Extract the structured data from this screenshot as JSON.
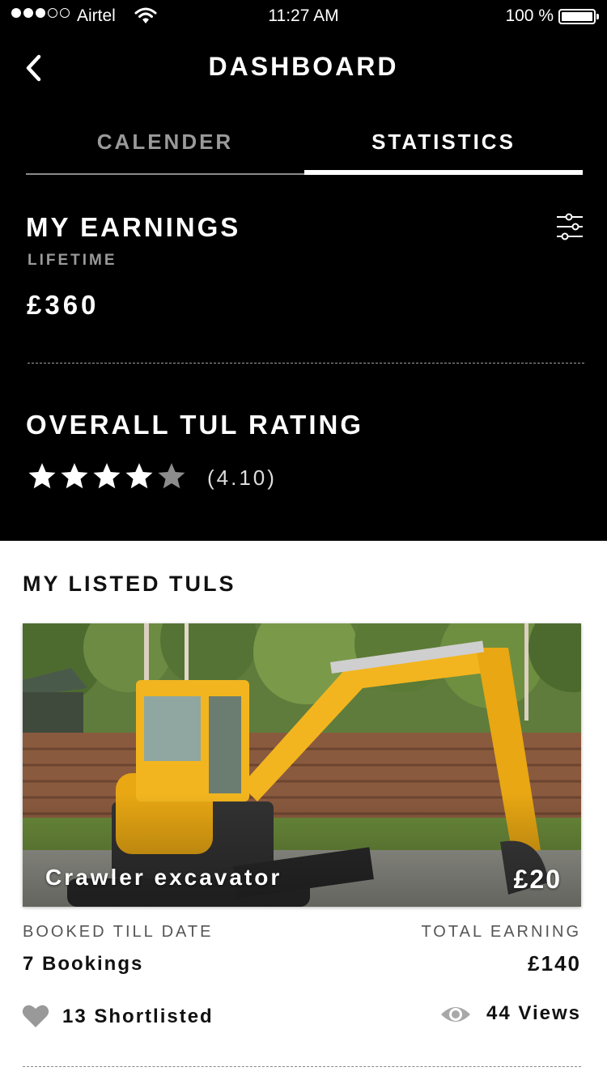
{
  "status_bar": {
    "carrier": "Airtel",
    "time": "11:27 AM",
    "battery": "100 %"
  },
  "header": {
    "title": "DASHBOARD"
  },
  "tabs": [
    {
      "label": "CALENDER",
      "active": false
    },
    {
      "label": "STATISTICS",
      "active": true
    }
  ],
  "earnings": {
    "title": "MY EARNINGS",
    "period": "LIFETIME",
    "value": "£360"
  },
  "rating": {
    "title": "OVERALL TUL RATING",
    "stars_filled": 4,
    "stars_total": 5,
    "value": "(4.10)"
  },
  "listed": {
    "title": "MY LISTED TULS",
    "items": [
      {
        "name": "Crawler excavator",
        "price": "£20",
        "booked_label": "BOOKED TILL DATE",
        "bookings": "7 Bookings",
        "total_label": "TOTAL EARNING",
        "total_value": "£140",
        "shortlisted": "13 Shortlisted",
        "views": "44 Views"
      }
    ]
  },
  "colors": {
    "header_bg": "#000000",
    "inactive_tab": "#9a9a9a",
    "accent_yellow": "#f2b51f"
  },
  "icons": {
    "back": "chevron-left-icon",
    "filter": "sliders-icon",
    "star": "star-icon",
    "heart": "heart-icon",
    "eye": "eye-icon",
    "wifi": "wifi-icon",
    "battery": "battery-icon"
  }
}
